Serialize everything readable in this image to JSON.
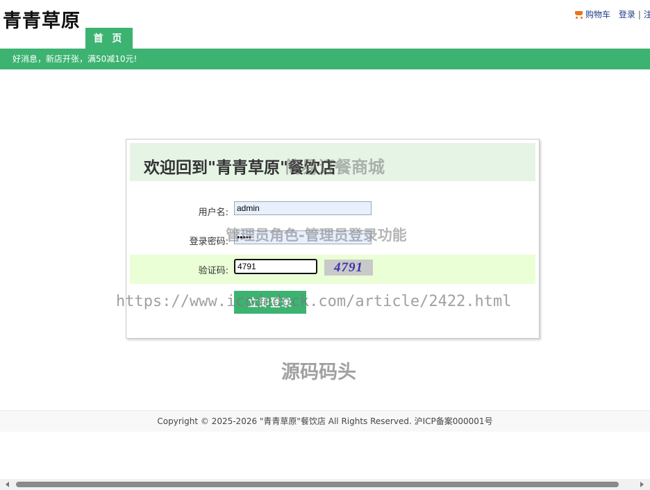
{
  "header": {
    "logo": "青青草原",
    "nav": [
      {
        "label": "首 页"
      }
    ],
    "links": {
      "cart": "购物车",
      "login": "登录",
      "separator": "|",
      "register_cut": "注"
    }
  },
  "notice": "好消息，新店开张，满50减10元!",
  "login": {
    "title": "欢迎回到\"青青草原\"餐饮店",
    "username": {
      "label": "用户名:",
      "value": "admin"
    },
    "password": {
      "label": "登录密码:",
      "value": "•••••"
    },
    "captcha": {
      "label": "验证码:",
      "value": "4791",
      "image_text": "4791"
    },
    "submit": "立即登录"
  },
  "watermarks": [
    "简易订餐商城",
    "管理员角色-管理员登录功能",
    "https://www.icodedock.com/article/2422.html",
    "源码码头"
  ],
  "footer": "Copyright © 2025-2026 \"青青草原\"餐饮店 All Rights Reserved. 沪ICP备案000001号",
  "colors": {
    "accent": "#3cb371",
    "title_bg": "#e6f4e6",
    "captcha_row_bg": "#eaffd6"
  },
  "icons": {
    "cart": "shopping-cart-icon"
  }
}
